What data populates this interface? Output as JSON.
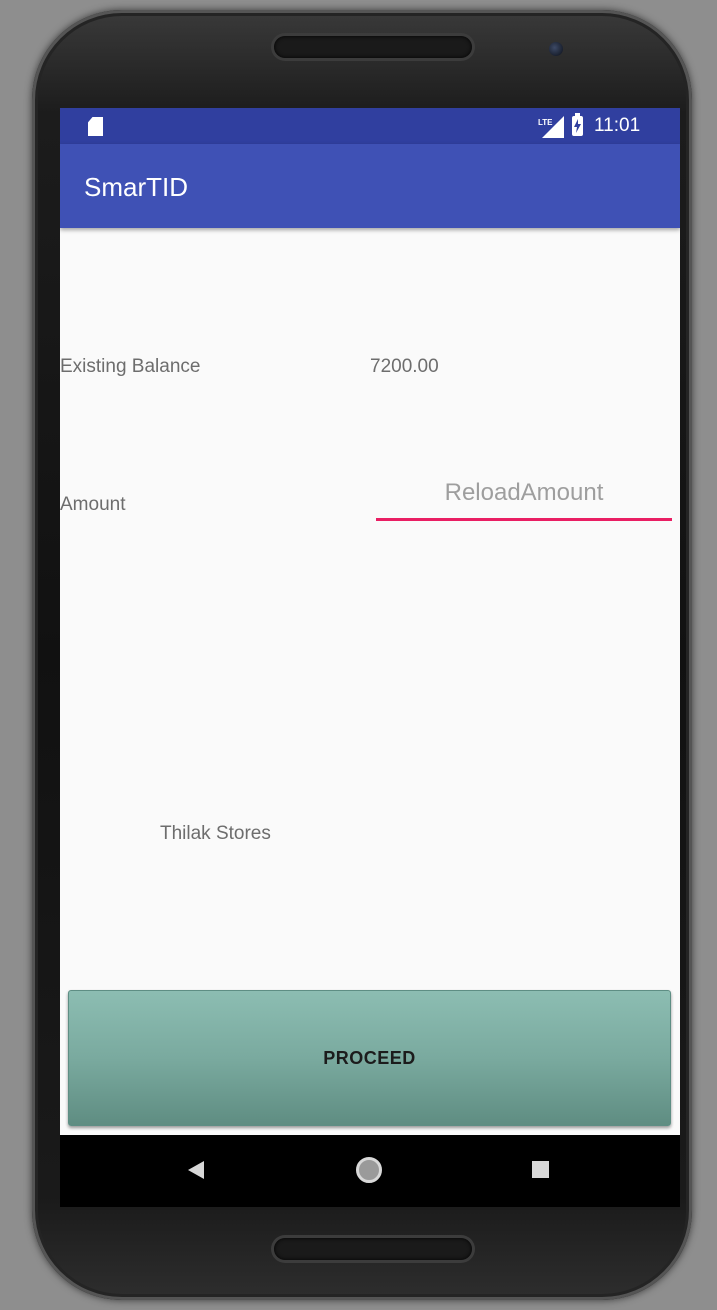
{
  "status_bar": {
    "time": "11:01",
    "sd_icon": "sd-card-icon",
    "network_icon": "lte-signal-icon",
    "battery_icon": "battery-charging-icon"
  },
  "app_bar": {
    "title": "SmarTID"
  },
  "form": {
    "existing_balance_label": "Existing Balance",
    "existing_balance_value": "7200.00",
    "amount_label": "Amount",
    "amount_placeholder": "ReloadAmount",
    "amount_value": ""
  },
  "store_name": "Thilak Stores",
  "proceed_button": {
    "label": "PROCEED"
  },
  "nav_bar": {
    "back_icon": "back-triangle-icon",
    "home_icon": "home-circle-icon",
    "recents_icon": "recents-square-icon"
  },
  "colors": {
    "status_bar": "#303f9f",
    "app_bar": "#3f51b5",
    "input_underline": "#e91e63",
    "button": "#7aaa9f"
  }
}
